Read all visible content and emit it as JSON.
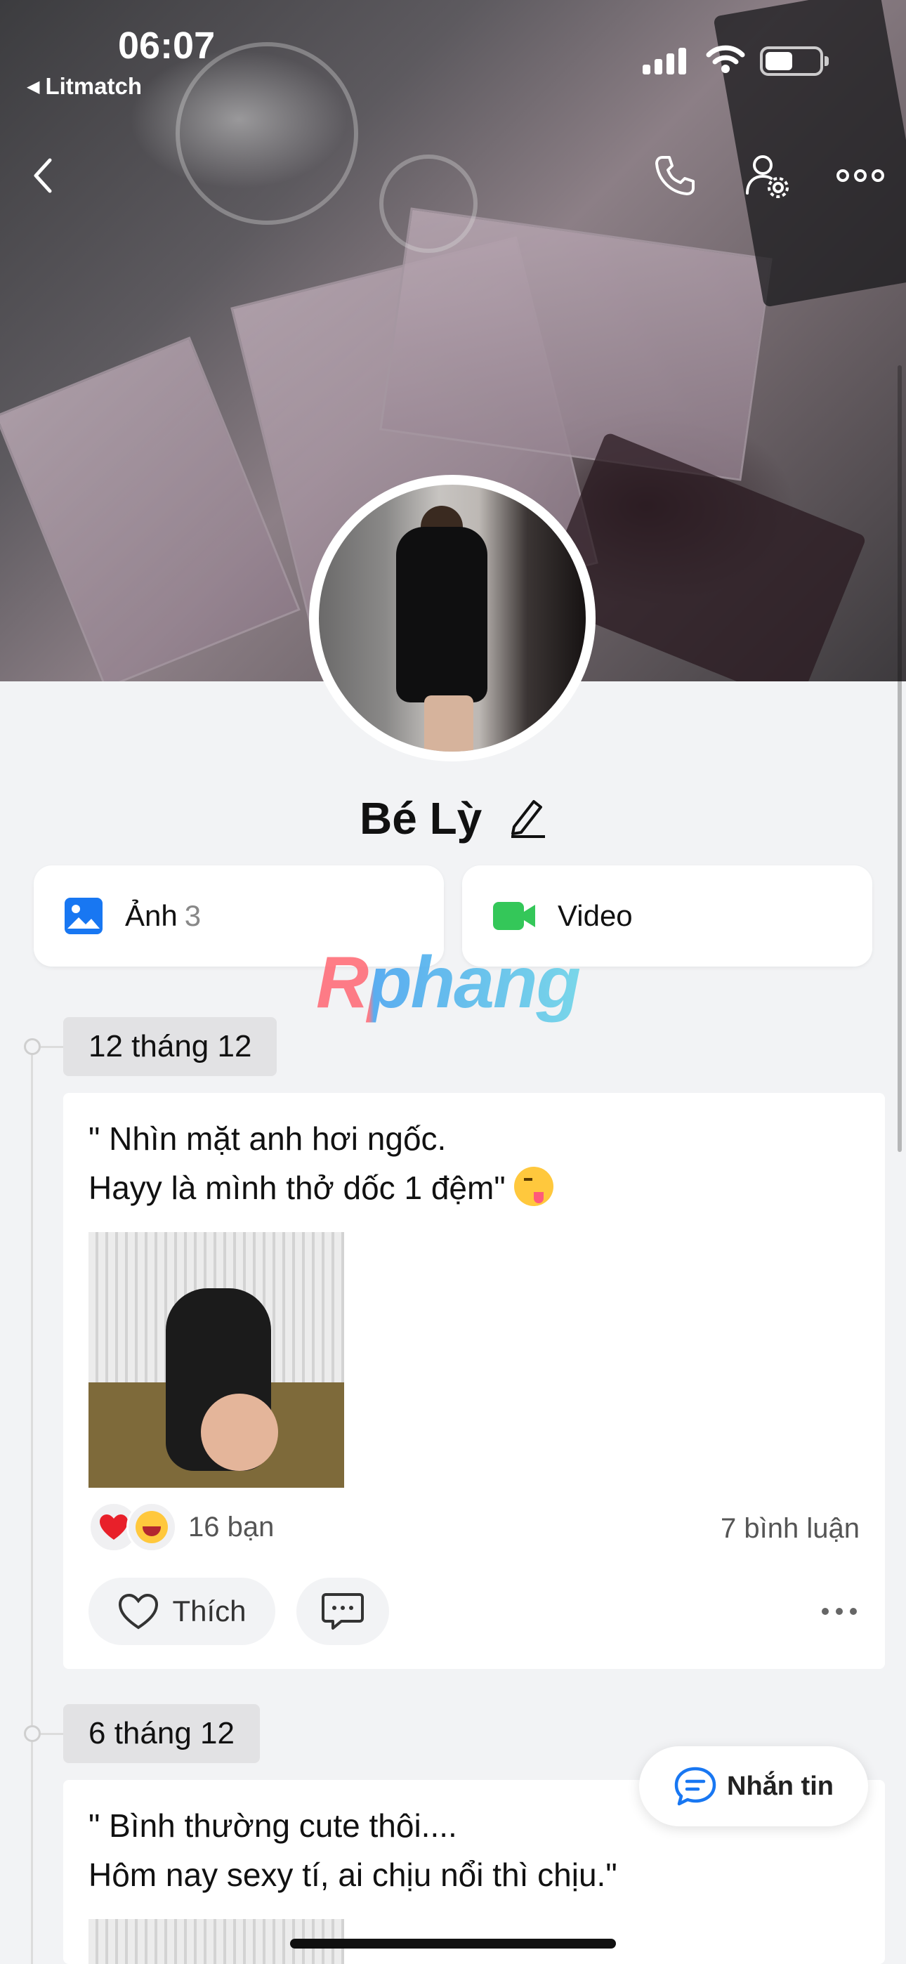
{
  "status_bar": {
    "time": "06:07",
    "back_app": "Litmatch"
  },
  "nav": {
    "back_icon": "chevron-left-icon",
    "call_icon": "phone-icon",
    "settings_icon": "user-settings-icon",
    "more_icon": "more-horizontal-icon"
  },
  "profile": {
    "name": "Bé Lỳ"
  },
  "media": {
    "photos_label": "Ảnh",
    "photos_count": "3",
    "video_label": "Video"
  },
  "watermark": "Rphang",
  "posts": [
    {
      "date": "12 tháng 12",
      "text_line1": "\" Nhìn mặt anh hơi ngốc.",
      "text_line2": "Hayy là mình thở dốc 1 đệm\"",
      "reactions_count": "16 bạn",
      "comments_count": "7 bình luận",
      "like_label": "Thích"
    },
    {
      "date": "6 tháng 12",
      "text_line1": "\" Bình thường cute thôi....",
      "text_line2": "Hôm nay sexy tí, ai chịu nổi thì chịu.\""
    }
  ],
  "message_button": "Nhắn tin",
  "colors": {
    "accent_blue": "#1877f2",
    "video_green": "#34c759",
    "heart_red": "#e8202a"
  }
}
